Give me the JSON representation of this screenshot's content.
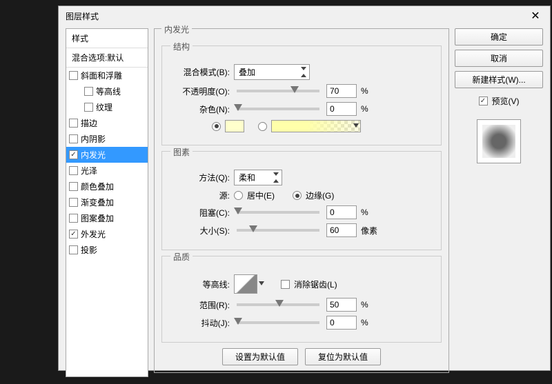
{
  "dialog": {
    "title": "图层样式"
  },
  "sidebar": {
    "styles_header": "样式",
    "blend_options": "混合选项:默认",
    "items": [
      {
        "label": "斜面和浮雕",
        "checked": false,
        "indent": false
      },
      {
        "label": "等高线",
        "checked": false,
        "indent": true
      },
      {
        "label": "纹理",
        "checked": false,
        "indent": true
      },
      {
        "label": "描边",
        "checked": false,
        "indent": false
      },
      {
        "label": "内阴影",
        "checked": false,
        "indent": false
      },
      {
        "label": "内发光",
        "checked": true,
        "indent": false,
        "selected": true
      },
      {
        "label": "光泽",
        "checked": false,
        "indent": false
      },
      {
        "label": "颜色叠加",
        "checked": false,
        "indent": false
      },
      {
        "label": "渐变叠加",
        "checked": false,
        "indent": false
      },
      {
        "label": "图案叠加",
        "checked": false,
        "indent": false
      },
      {
        "label": "外发光",
        "checked": true,
        "indent": false
      },
      {
        "label": "投影",
        "checked": false,
        "indent": false
      }
    ]
  },
  "main": {
    "title": "内发光",
    "structure": {
      "legend": "结构",
      "blend_mode_label": "混合模式(B):",
      "blend_mode_value": "叠加",
      "opacity_label": "不透明度(O):",
      "opacity_value": "70",
      "opacity_unit": "%",
      "noise_label": "杂色(N):",
      "noise_value": "0",
      "noise_unit": "%",
      "color_solid": "#ffffaa"
    },
    "elements": {
      "legend": "图素",
      "technique_label": "方法(Q):",
      "technique_value": "柔和",
      "source_label": "源:",
      "source_center": "居中(E)",
      "source_edge": "边缘(G)",
      "choke_label": "阻塞(C):",
      "choke_value": "0",
      "choke_unit": "%",
      "size_label": "大小(S):",
      "size_value": "60",
      "size_unit": "像素"
    },
    "quality": {
      "legend": "品质",
      "contour_label": "等高线:",
      "antialias_label": "消除锯齿(L)",
      "range_label": "范围(R):",
      "range_value": "50",
      "range_unit": "%",
      "jitter_label": "抖动(J):",
      "jitter_value": "0",
      "jitter_unit": "%"
    },
    "bottom": {
      "make_default": "设置为默认值",
      "reset_default": "复位为默认值"
    }
  },
  "right": {
    "ok": "确定",
    "cancel": "取消",
    "new_style": "新建样式(W)...",
    "preview_label": "预览(V)"
  }
}
